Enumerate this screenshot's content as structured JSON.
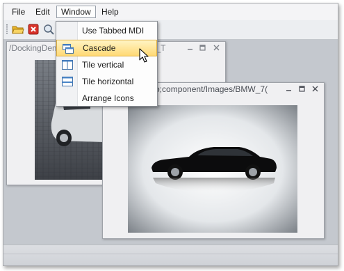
{
  "menubar": {
    "items": [
      "File",
      "Edit",
      "Window",
      "Help"
    ]
  },
  "toolbar": {
    "icons": [
      "grip-icon",
      "open-folder-icon",
      "close-document-icon",
      "search-icon"
    ]
  },
  "back_window": {
    "title": "/DockingDemo;component/Images/Audi_T"
  },
  "front_window": {
    "title": "/DockingDemo;component/Images/BMW_7(",
    "image_alt": "black sedan car on white studio background"
  },
  "window_menu": {
    "items": [
      {
        "label": "Use Tabbed MDI",
        "icon": ""
      },
      {
        "label": "Cascade",
        "icon": "cascade-icon"
      },
      {
        "label": "Tile vertical",
        "icon": "tile-vertical-icon"
      },
      {
        "label": "Tile horizontal",
        "icon": "tile-horizontal-icon"
      },
      {
        "label": "Arrange Icons",
        "icon": ""
      }
    ],
    "highlighted": "Cascade"
  },
  "colors": {
    "highlight": "#ffd975",
    "mdi_background": "#c4c8ce",
    "accent_icon": "#4a86c8"
  }
}
